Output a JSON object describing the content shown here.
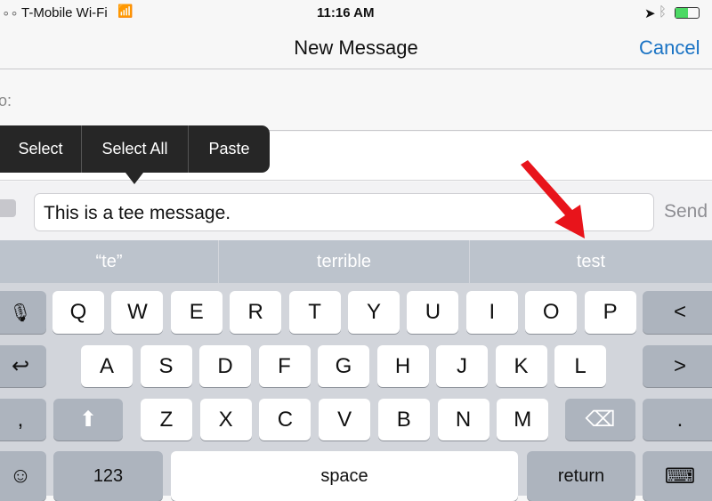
{
  "status_bar": {
    "carrier": "T-Mobile Wi-Fi",
    "time": "11:16 AM",
    "battery_color": "#4cd964"
  },
  "nav": {
    "title": "New Message",
    "cancel": "Cancel",
    "accent": "#1a73c4"
  },
  "to_label": "o:",
  "edit_menu": [
    "Select",
    "Select All",
    "Paste"
  ],
  "compose": {
    "message": "This is a tee message.",
    "send": "Send"
  },
  "suggestions": [
    "“te”",
    "terrible",
    "test"
  ],
  "annotation": {
    "arrow_color": "#e8141b"
  },
  "keyboard": {
    "row1": [
      "Q",
      "W",
      "E",
      "R",
      "T",
      "Y",
      "U",
      "I",
      "O",
      "P"
    ],
    "row2": [
      "A",
      "S",
      "D",
      "F",
      "G",
      "H",
      "J",
      "K",
      "L"
    ],
    "row3": [
      "Z",
      "X",
      "C",
      "V",
      "B",
      "N",
      "M"
    ],
    "left_keys": [
      "microphone-icon",
      "undo-icon",
      ",",
      "emoji-icon"
    ],
    "right_keys": [
      "<",
      ">",
      "."
    ],
    "numbers": "123",
    "space": "space",
    "return": "return"
  }
}
